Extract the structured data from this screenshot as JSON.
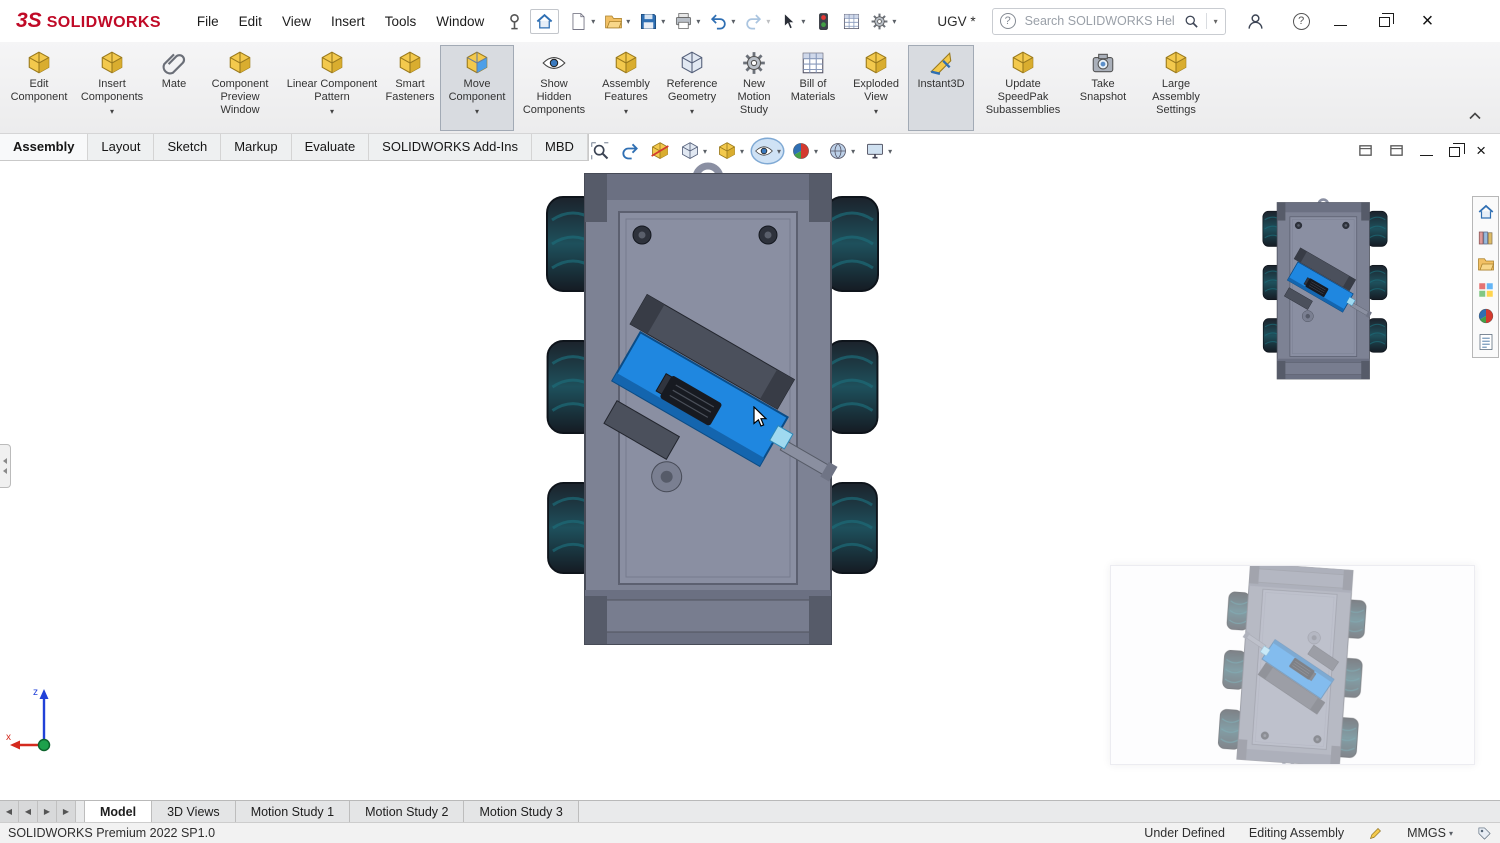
{
  "colors": {
    "brand_red": "#c00a27",
    "active_highlight": "#d8dbe0",
    "arm_blue": "#1f87e0"
  },
  "titlebar": {
    "logo_mark": "3S",
    "brand": "SOLIDWORKS",
    "menus": [
      "File",
      "Edit",
      "View",
      "Insert",
      "Tools",
      "Window"
    ],
    "quick_access_icons": [
      "pin",
      "home",
      "new-document",
      "open",
      "save",
      "print",
      "undo",
      "redo",
      "select",
      "interference-check",
      "design-table",
      "options"
    ],
    "document": "UGV *",
    "search_placeholder": "Search SOLIDWORKS Help",
    "right_icons": [
      "user-profile",
      "help"
    ],
    "window_controls": [
      "minimize",
      "restore",
      "close"
    ]
  },
  "ribbon": {
    "buttons": [
      {
        "id": "edit-component",
        "lines": [
          "Edit",
          "Component"
        ],
        "caret": false,
        "active": false
      },
      {
        "id": "insert-components",
        "lines": [
          "Insert",
          "Components"
        ],
        "caret": true,
        "active": false
      },
      {
        "id": "mate",
        "lines": [
          "Mate"
        ],
        "caret": false,
        "active": false
      },
      {
        "id": "component-preview-window",
        "lines": [
          "Component",
          "Preview",
          "Window"
        ],
        "caret": false,
        "active": false
      },
      {
        "id": "linear-component-pattern",
        "lines": [
          "Linear Component",
          "Pattern"
        ],
        "caret": true,
        "active": false
      },
      {
        "id": "smart-fasteners",
        "lines": [
          "Smart",
          "Fasteners"
        ],
        "caret": false,
        "active": false
      },
      {
        "id": "move-component",
        "lines": [
          "Move",
          "Component"
        ],
        "caret": true,
        "active": true
      },
      {
        "id": "show-hidden-components",
        "lines": [
          "Show",
          "Hidden",
          "Components"
        ],
        "caret": false,
        "active": false
      },
      {
        "id": "assembly-features",
        "lines": [
          "Assembly",
          "Features"
        ],
        "caret": true,
        "active": false
      },
      {
        "id": "reference-geometry",
        "lines": [
          "Reference",
          "Geometry"
        ],
        "caret": true,
        "active": false
      },
      {
        "id": "new-motion-study",
        "lines": [
          "New",
          "Motion",
          "Study"
        ],
        "caret": false,
        "active": false
      },
      {
        "id": "bill-of-materials",
        "lines": [
          "Bill of",
          "Materials"
        ],
        "caret": false,
        "active": false
      },
      {
        "id": "exploded-view",
        "lines": [
          "Exploded",
          "View"
        ],
        "caret": true,
        "active": false
      },
      {
        "id": "instant3d",
        "lines": [
          "Instant3D"
        ],
        "caret": false,
        "active": true
      },
      {
        "id": "update-speedpak-subassemblies",
        "lines": [
          "Update",
          "SpeedPak",
          "Subassemblies"
        ],
        "caret": false,
        "active": false
      },
      {
        "id": "take-snapshot",
        "lines": [
          "Take",
          "Snapshot"
        ],
        "caret": false,
        "active": false
      },
      {
        "id": "large-assembly-settings",
        "lines": [
          "Large",
          "Assembly",
          "Settings"
        ],
        "caret": false,
        "active": false
      }
    ]
  },
  "command_tabs": {
    "items": [
      "Assembly",
      "Layout",
      "Sketch",
      "Markup",
      "Evaluate",
      "SOLIDWORKS Add-Ins",
      "MBD"
    ],
    "active": "Assembly"
  },
  "headsup_icons": [
    "zoom-to-fit",
    "zoom-to-area",
    "previous-view",
    "section-view",
    "view-orientation",
    "display-style",
    "hide-show-items",
    "edit-appearance",
    "apply-scene",
    "view-settings"
  ],
  "viewport_controls": [
    "pane-left",
    "pane-right",
    "minimize",
    "restore",
    "close"
  ],
  "taskpane_icons": [
    "solidworks-resources",
    "design-library",
    "file-explorer",
    "view-palette",
    "appearances-scenes",
    "custom-properties"
  ],
  "triad": {
    "x": "x",
    "z": "z"
  },
  "model_colors": {
    "chassis": "#7d8294",
    "wheel": "#1c222b",
    "wheel_tread": "#1d6b78",
    "arm_blue": "#1f87e0"
  },
  "bottom_tabs": {
    "items": [
      "Model",
      "3D Views",
      "Motion Study 1",
      "Motion Study 2",
      "Motion Study 3"
    ],
    "active": "Model"
  },
  "statusbar": {
    "product": "SOLIDWORKS Premium 2022 SP1.0",
    "definition": "Under Defined",
    "mode": "Editing Assembly",
    "units": "MMGS"
  }
}
